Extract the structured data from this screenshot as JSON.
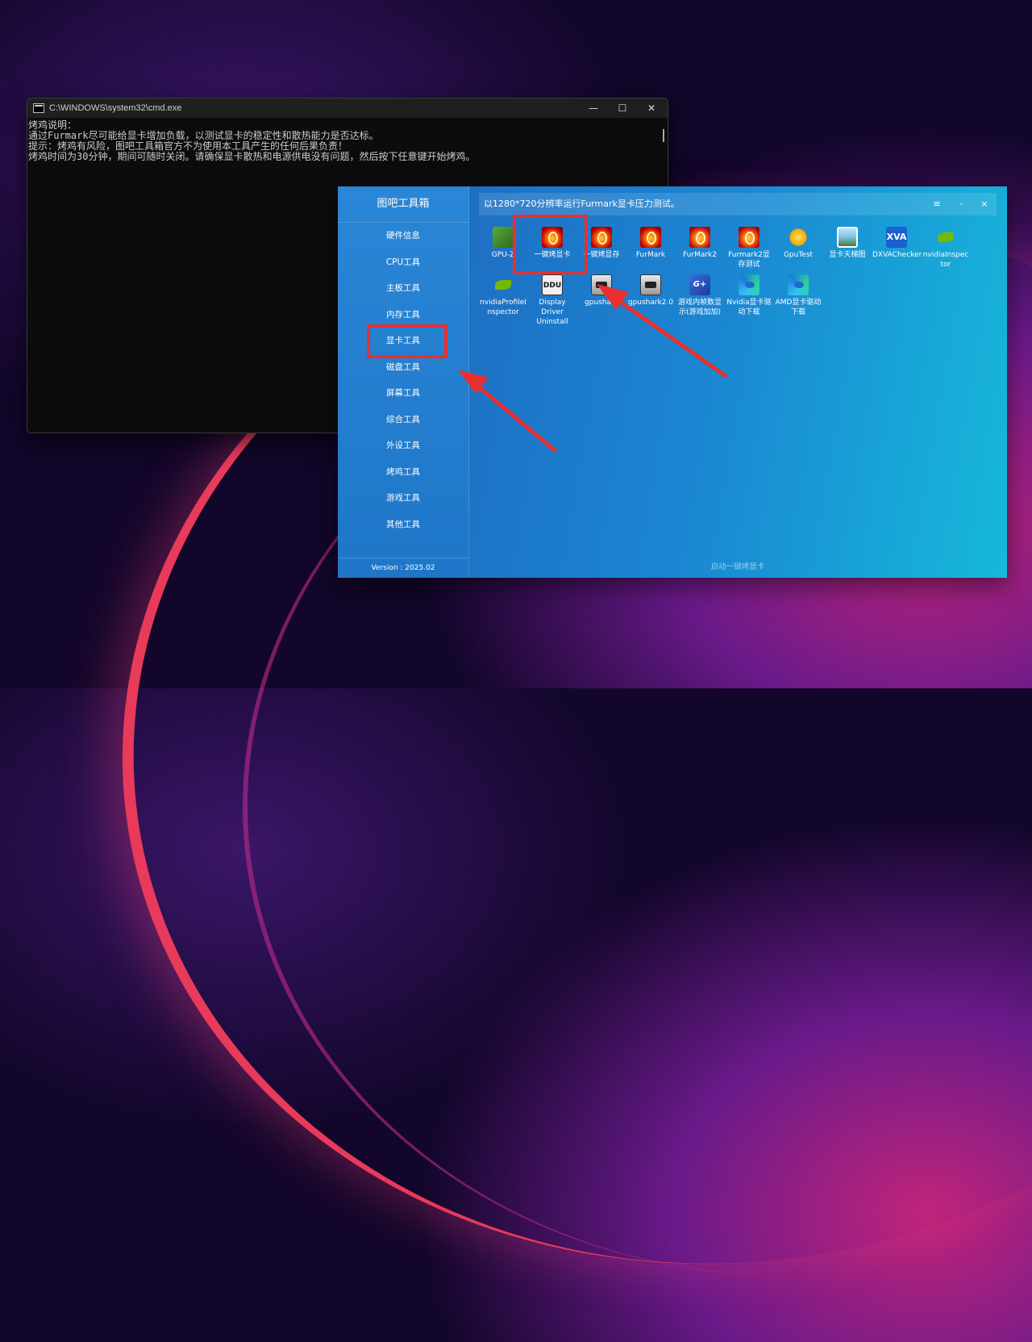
{
  "cmd": {
    "title": "C:\\WINDOWS\\system32\\cmd.exe",
    "lines": [
      "烤鸡说明：",
      "通过Furmark尽可能给显卡增加负载，以测试显卡的稳定性和散热能力是否达标。",
      "提示：烤鸡有风险，图吧工具箱官方不为使用本工具产生的任何后果负责！",
      "烤鸡时间为30分钟，期间可随时关闭。请确保显卡散热和电源供电没有问题，然后按下任意键开始烤鸡。"
    ],
    "controls": {
      "minimize": "—",
      "maximize": "☐",
      "close": "✕"
    }
  },
  "toolbox": {
    "title": "图吧工具箱",
    "sidebar": [
      {
        "label": "硬件信息"
      },
      {
        "label": "CPU工具"
      },
      {
        "label": "主板工具"
      },
      {
        "label": "内存工具"
      },
      {
        "label": "显卡工具",
        "active": true
      },
      {
        "label": "磁盘工具"
      },
      {
        "label": "屏幕工具"
      },
      {
        "label": "综合工具"
      },
      {
        "label": "外设工具"
      },
      {
        "label": "烤鸡工具"
      },
      {
        "label": "游戏工具"
      },
      {
        "label": "其他工具"
      }
    ],
    "version": "Version : 2025.02",
    "header_text": "以1280*720分辨率运行Furmark显卡压力测试。",
    "header_buttons": {
      "menu": "≡",
      "minimize": "-",
      "close": "×"
    },
    "tools": [
      {
        "label": "GPU-Z",
        "icon": "gpuz-icon"
      },
      {
        "label": "一键烤显卡",
        "icon": "furmark-icon"
      },
      {
        "label": "一键烤显存",
        "icon": "furmark-icon"
      },
      {
        "label": "FurMark",
        "icon": "furmark-icon"
      },
      {
        "label": "FurMark2",
        "icon": "furmark2-icon"
      },
      {
        "label": "Furmark2显存测试",
        "icon": "furmark2-icon"
      },
      {
        "label": "GpuTest",
        "icon": "gputest-icon"
      },
      {
        "label": "显卡天梯图",
        "icon": "landscape-icon"
      },
      {
        "label": "DXVAChecker",
        "icon": "xva-icon"
      },
      {
        "label": "nvidiaInspector",
        "icon": "nvidia-icon"
      },
      {
        "label": "nvidiaProfileInspector",
        "icon": "nvidia-icon"
      },
      {
        "label": "Display Driver Uninstall",
        "icon": "ddu-icon"
      },
      {
        "label": "gpushark",
        "icon": "gpushark-icon"
      },
      {
        "label": "gpushark2.0",
        "icon": "gpushark-icon"
      },
      {
        "label": "游戏内帧数显示(游戏加加)",
        "icon": "gplus-icon"
      },
      {
        "label": "Nvidia显卡驱动下载",
        "icon": "edge-icon"
      },
      {
        "label": "AMD显卡驱动下载",
        "icon": "edge-icon"
      }
    ],
    "status": "启动一键烤显卡",
    "icon_text": {
      "xva": "XVA",
      "ddu": "DDU",
      "gplus": "G+"
    }
  },
  "colors": {
    "highlight": "#e8302e",
    "toolbox_bg": "#1e8ad8"
  }
}
